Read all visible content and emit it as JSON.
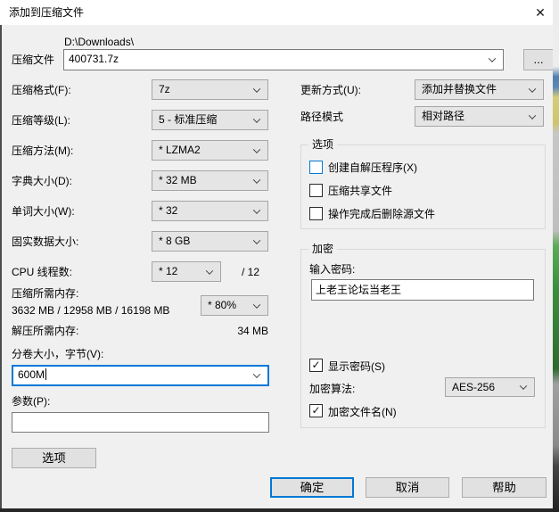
{
  "titlebar": {
    "title": "添加到压缩文件",
    "close_icon": "✕"
  },
  "archive": {
    "label": "压缩文件",
    "directory": "D:\\Downloads\\",
    "filename": "400731.7z",
    "browse_label": "..."
  },
  "left_fields": {
    "format": {
      "label": "压缩格式(F):",
      "value": "7z"
    },
    "level": {
      "label": "压缩等级(L):",
      "value": "5 - 标准压缩"
    },
    "method": {
      "label": "压缩方法(M):",
      "value": "* LZMA2"
    },
    "dictionary": {
      "label": "字典大小(D):",
      "value": "* 32 MB"
    },
    "word": {
      "label": "单词大小(W):",
      "value": "* 32"
    },
    "solid": {
      "label": "固实数据大小:",
      "value": "* 8 GB"
    },
    "threads": {
      "label": "CPU 线程数:",
      "value": "* 12",
      "suffix": "/ 12"
    },
    "mem_compress": {
      "label": "压缩所需内存:",
      "detail": "3632 MB / 12958 MB / 16198 MB",
      "value": "* 80%"
    },
    "mem_decompress": {
      "label": "解压所需内存:",
      "value": "34 MB"
    },
    "split": {
      "label": "分卷大小，字节(V):",
      "value": "600M"
    },
    "params": {
      "label": "参数(P):",
      "value": ""
    },
    "options_button": "选项"
  },
  "right_fields": {
    "update_mode": {
      "label": "更新方式(U):",
      "value": "添加并替换文件"
    },
    "path_mode": {
      "label": "路径模式",
      "value": "相对路径"
    },
    "options_group": {
      "title": "选项",
      "checkboxes": [
        {
          "label": "创建自解压程序(X)",
          "mark": ""
        },
        {
          "label": "压缩共享文件",
          "mark": ""
        },
        {
          "label": "操作完成后删除源文件",
          "mark": ""
        }
      ]
    },
    "encryption_group": {
      "title": "加密",
      "password_label": "输入密码:",
      "password_value": "上老王论坛当老王",
      "show_password": {
        "label": "显示密码(S)",
        "mark": "✓"
      },
      "method": {
        "label": "加密算法:",
        "value": "AES-256"
      },
      "encrypt_names": {
        "label": "加密文件名(N)",
        "mark": "✓"
      }
    }
  },
  "footer": {
    "ok": "确定",
    "cancel": "取消",
    "help": "帮助"
  },
  "colors": {
    "accent": "#0078d7",
    "dialog_bg": "#f0f0f0",
    "titlebar_bg": "#ffffff"
  }
}
